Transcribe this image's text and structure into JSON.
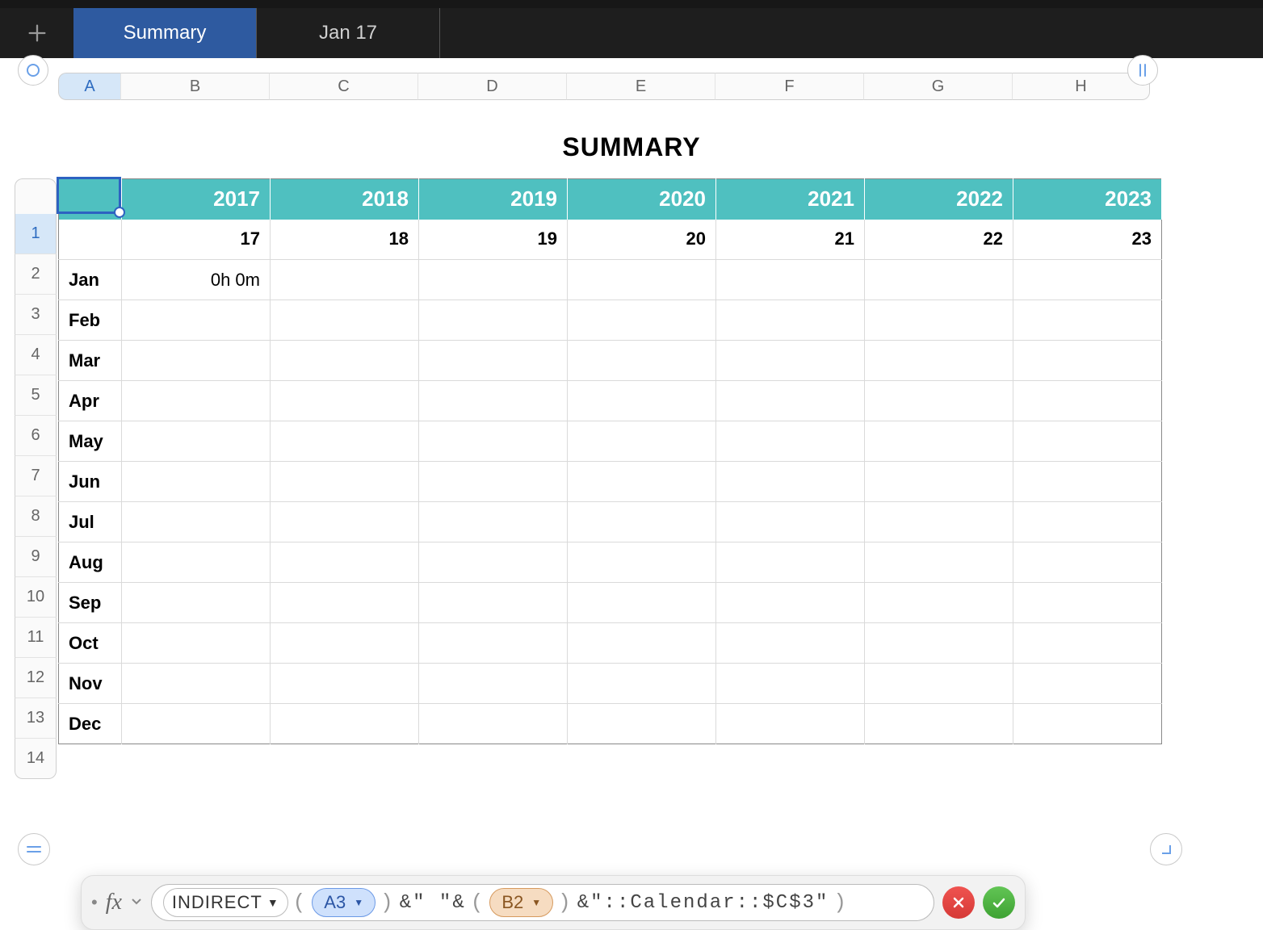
{
  "tabs": {
    "active": "Summary",
    "inactive": "Jan 17"
  },
  "columns": [
    "A",
    "B",
    "C",
    "D",
    "E",
    "F",
    "G",
    "H"
  ],
  "selected_column_index": 0,
  "table_title": "SUMMARY",
  "row_numbers": [
    "1",
    "2",
    "3",
    "4",
    "5",
    "6",
    "7",
    "8",
    "9",
    "10",
    "11",
    "12",
    "13",
    "14"
  ],
  "selected_row_index": 0,
  "years_header": [
    "",
    "2017",
    "2018",
    "2019",
    "2020",
    "2021",
    "2022",
    "2023"
  ],
  "row2": [
    "",
    "17",
    "18",
    "19",
    "20",
    "21",
    "22",
    "23"
  ],
  "months": [
    "Jan",
    "Feb",
    "Mar",
    "Apr",
    "May",
    "Jun",
    "Jul",
    "Aug",
    "Sep",
    "Oct",
    "Nov",
    "Dec"
  ],
  "jan_2017_value": "0h 0m",
  "formula": {
    "function_name": "INDIRECT",
    "ref1": "A3",
    "literal1": "&\" \"&",
    "ref2": "B2",
    "literal2": "&\"::Calendar::$C$3\""
  }
}
